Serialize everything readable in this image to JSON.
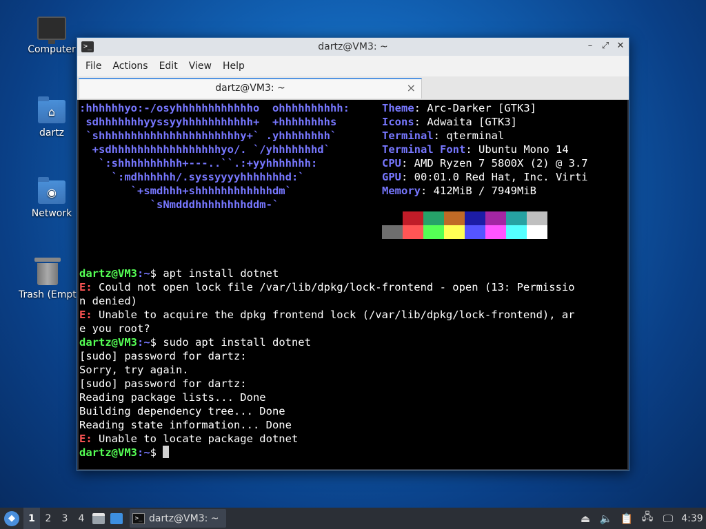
{
  "desktop": {
    "icons": [
      {
        "label": "Computer",
        "icon": "computer-icon"
      },
      {
        "label": "dartz",
        "icon": "home-folder-icon"
      },
      {
        "label": "Network",
        "icon": "network-folder-icon"
      },
      {
        "label": "Trash (Empty)",
        "icon": "trash-icon"
      }
    ]
  },
  "window": {
    "title": "dartz@VM3: ~",
    "menu": [
      "File",
      "Actions",
      "Edit",
      "View",
      "Help"
    ],
    "tab_title": "dartz@VM3: ~",
    "tab_close": "×",
    "controls": {
      "minimize": "–",
      "maximize": "⤢",
      "close": "✕"
    }
  },
  "terminal": {
    "logo_lines": [
      ":hhhhhhyo:-/osyhhhhhhhhhhhho  ohhhhhhhhhh:",
      " sdhhhhhhhyyssyyhhhhhhhhhhh+  +hhhhhhhhs",
      " `shhhhhhhhhhhhhhhhhhhhhhy+` .yhhhhhhhh`",
      "  +sdhhhhhhhhhhhhhhhhhyo/. `/yhhhhhhhd`",
      "   `:shhhhhhhhhh+---..``.:+yyhhhhhhh:",
      "     `:mdhhhhhh/.syssyyyyhhhhhhhd:`",
      "        `+smdhhh+shhhhhhhhhhhhdm`",
      "           `sNmdddhhhhhhhhddm-`"
    ],
    "info": [
      {
        "key": "Theme",
        "value": "Arc-Darker [GTK3]"
      },
      {
        "key": "Icons",
        "value": "Adwaita [GTK3]"
      },
      {
        "key": "Terminal",
        "value": "qterminal"
      },
      {
        "key": "Terminal Font",
        "value": "Ubuntu Mono 14"
      },
      {
        "key": "CPU",
        "value": "AMD Ryzen 7 5800X (2) @ 3.7"
      },
      {
        "key": "GPU",
        "value": "00:01.0 Red Hat, Inc. Virti"
      },
      {
        "key": "Memory",
        "value": "412MiB / 7949MiB"
      }
    ],
    "palette_row1": [
      "#000000",
      "#c01c28",
      "#26a269",
      "#c06a26",
      "#1c1ca6",
      "#a326a3",
      "#26a2a2",
      "#bfbfbf"
    ],
    "palette_row2": [
      "#6e6e6e",
      "#ff5555",
      "#55ff55",
      "#ffff55",
      "#5555ff",
      "#ff55ff",
      "#55ffff",
      "#ffffff"
    ],
    "prompt_user": "dartz@VM3",
    "prompt_path": ":~",
    "prompt_sym": "$ ",
    "cmd1": "apt install dotnet",
    "err_prefix": "E:",
    "err1a": " Could not open lock file /var/lib/dpkg/lock-frontend - open (13: Permissio",
    "err1b": "n denied)",
    "err2a": " Unable to acquire the dpkg frontend lock (/var/lib/dpkg/lock-frontend), ar",
    "err2b": "e you root?",
    "cmd2": "sudo apt install dotnet",
    "out1": "[sudo] password for dartz:",
    "out2": "Sorry, try again.",
    "out3": "[sudo] password for dartz:",
    "out4": "Reading package lists... Done",
    "out5": "Building dependency tree... Done",
    "out6": "Reading state information... Done",
    "err3": " Unable to locate package dotnet"
  },
  "taskbar": {
    "workspaces": [
      "1",
      "2",
      "3",
      "4"
    ],
    "active_workspace": "1",
    "task_label": "dartz@VM3: ~",
    "clock": "4:39"
  }
}
